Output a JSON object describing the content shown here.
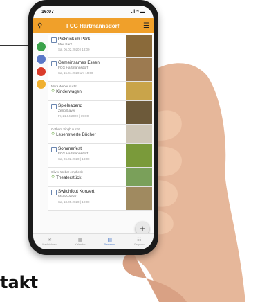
{
  "heading": "takt",
  "status_bar": {
    "time": "16:07",
    "indicators": "..l ≈ ▬"
  },
  "app": {
    "title": "FCG Hartmannsdorf"
  },
  "sidebar_colors": [
    "#3aa24a",
    "#5a78c8",
    "#d93a2a",
    "#f0b030"
  ],
  "feed": [
    {
      "kind": "event",
      "title": "Picknick im Park",
      "sub": "Max Kurz",
      "date": "Sa, 06.02.2020 | 18:00",
      "img": "#8a6a3a"
    },
    {
      "kind": "event",
      "title": "Gemeinsames Essen",
      "sub": "FCG Hartmannsdorf",
      "date": "Sa, 15.04.2020 um 19:00",
      "img": "#9c7a50"
    },
    {
      "kind": "wish",
      "who": "Mara Weber sucht",
      "title": "Kinderwagen",
      "img": "#c9a44a"
    },
    {
      "kind": "event",
      "title": "Spieleabend",
      "sub": "Zeno Bayer",
      "date": "Fr, 21.04.2020 | 19:00",
      "img": "#6d5a3a"
    },
    {
      "kind": "wish",
      "who": "Gotham Singh sucht",
      "title": "Lesenswerte Bücher",
      "img": "#cfc7b8"
    },
    {
      "kind": "event",
      "title": "Sommerfest",
      "sub": "FCG Hartmannsdorf",
      "date": "Sa, 06.02.2020 | 18:00",
      "img": "#7a9a3a"
    },
    {
      "kind": "wish",
      "who": "Oliver Weber empfiehlt",
      "title": "Theaterstück",
      "img": "#7aa05a"
    },
    {
      "kind": "event",
      "title": "Switchfoot Konzert",
      "sub": "Mara Weber",
      "date": "Sa, 18.05.2020 | 19:00",
      "img": "#a08a60"
    }
  ],
  "tabs": [
    {
      "label": "Nachrichten",
      "icon": "✉"
    },
    {
      "label": "Kalender",
      "icon": "▦"
    },
    {
      "label": "Pinnwand",
      "icon": "▤"
    },
    {
      "label": "Gruppen",
      "icon": "☷"
    }
  ],
  "fab": "+"
}
